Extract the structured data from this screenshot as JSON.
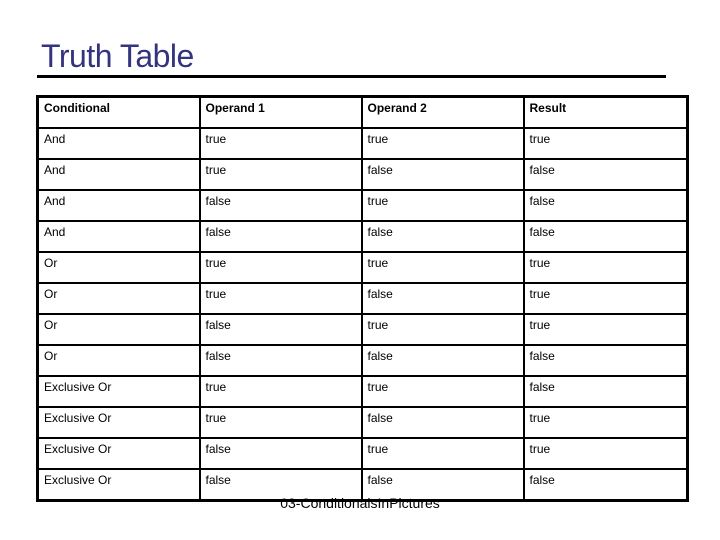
{
  "slide": {
    "title": "Truth Table",
    "footer": "03-ConditionalsInPictures"
  },
  "table": {
    "headers": [
      "Conditional",
      "Operand 1",
      "Operand 2",
      "Result"
    ],
    "rows": [
      [
        "And",
        "true",
        "true",
        "true"
      ],
      [
        "And",
        "true",
        "false",
        "false"
      ],
      [
        "And",
        "false",
        "true",
        "false"
      ],
      [
        "And",
        "false",
        "false",
        "false"
      ],
      [
        "Or",
        "true",
        "true",
        "true"
      ],
      [
        "Or",
        "true",
        "false",
        "true"
      ],
      [
        "Or",
        "false",
        "true",
        "true"
      ],
      [
        "Or",
        "false",
        "false",
        "false"
      ],
      [
        "Exclusive Or",
        "true",
        "true",
        "false"
      ],
      [
        "Exclusive Or",
        "true",
        "false",
        "true"
      ],
      [
        "Exclusive Or",
        "false",
        "true",
        "true"
      ],
      [
        "Exclusive Or",
        "false",
        "false",
        "false"
      ]
    ]
  },
  "colors": {
    "title": "#333380"
  }
}
